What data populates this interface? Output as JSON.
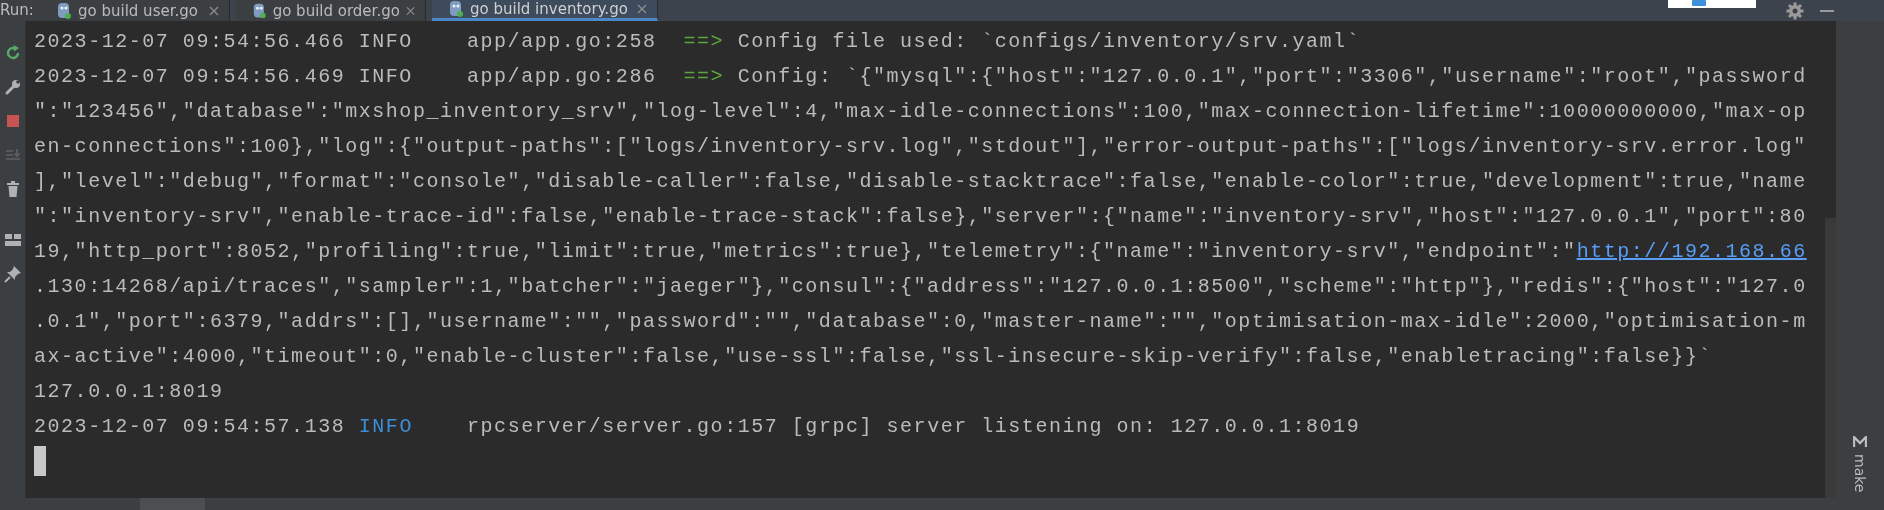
{
  "run_label": "Run:",
  "tabs": [
    {
      "label": "go build user.go",
      "selected": false
    },
    {
      "label": "go build order.go",
      "selected": false
    },
    {
      "label": "go build inventory.go",
      "selected": true
    }
  ],
  "console": {
    "cursor": true,
    "lines": [
      {
        "segments": [
          {
            "kind": "text",
            "text": "2023-12-07 09:54:56.466 INFO    app/app.go:258  "
          },
          {
            "kind": "arrow",
            "text": "==>"
          },
          {
            "kind": "text",
            "text": " Config file used: `configs/inventory/srv.yaml`"
          }
        ]
      },
      {
        "segments": [
          {
            "kind": "text",
            "text": "2023-12-07 09:54:56.469 INFO    app/app.go:286  "
          },
          {
            "kind": "arrow",
            "text": "==>"
          },
          {
            "kind": "text",
            "text": " Config: `{\"mysql\":{\"host\":\"127.0.0.1\",\"port\":\"3306\",\"username\":\"root\",\"password"
          }
        ]
      },
      {
        "segments": [
          {
            "kind": "text",
            "text": "\":\"123456\",\"database\":\"mxshop_inventory_srv\",\"log-level\":4,\"max-idle-connections\":100,\"max-connection-lifetime\":10000000000,\"max-op"
          }
        ]
      },
      {
        "segments": [
          {
            "kind": "text",
            "text": "en-connections\":100},\"log\":{\"output-paths\":[\"logs/inventory-srv.log\",\"stdout\"],\"error-output-paths\":[\"logs/inventory-srv.error.log\""
          }
        ]
      },
      {
        "segments": [
          {
            "kind": "text",
            "text": "],\"level\":\"debug\",\"format\":\"console\",\"disable-caller\":false,\"disable-stacktrace\":false,\"enable-color\":true,\"development\":true,\"name"
          }
        ]
      },
      {
        "segments": [
          {
            "kind": "text",
            "text": "\":\"inventory-srv\",\"enable-trace-id\":false,\"enable-trace-stack\":false},\"server\":{\"name\":\"inventory-srv\",\"host\":\"127.0.0.1\",\"port\":80"
          }
        ]
      },
      {
        "segments": [
          {
            "kind": "text",
            "text": "19,\"http_port\":8052,\"profiling\":true,\"limit\":true,\"metrics\":true},\"telemetry\":{\"name\":\"inventory-srv\",\"endpoint\":\""
          },
          {
            "kind": "link",
            "text": "http://192.168.66"
          }
        ]
      },
      {
        "segments": [
          {
            "kind": "text",
            "text": ".130:14268/api/traces\",\"sampler\":1,\"batcher\":\"jaeger\"},\"consul\":{\"address\":\"127.0.0.1:8500\",\"scheme\":\"http\"},\"redis\":{\"host\":\"127.0"
          }
        ]
      },
      {
        "segments": [
          {
            "kind": "text",
            "text": ".0.1\",\"port\":6379,\"addrs\":[],\"username\":\"\",\"password\":\"\",\"database\":0,\"master-name\":\"\",\"optimisation-max-idle\":2000,\"optimisation-m"
          }
        ]
      },
      {
        "segments": [
          {
            "kind": "text",
            "text": "ax-active\":4000,\"timeout\":0,\"enable-cluster\":false,\"use-ssl\":false,\"ssl-insecure-skip-verify\":false,\"enabletracing\":false}}`"
          }
        ]
      },
      {
        "segments": [
          {
            "kind": "text",
            "text": "127.0.0.1:8019"
          }
        ]
      },
      {
        "segments": [
          {
            "kind": "text",
            "text": "2023-12-07 09:54:57.138 "
          },
          {
            "kind": "info",
            "text": "INFO"
          },
          {
            "kind": "text",
            "text": "    rpcserver/server.go:157 [grpc] server listening on: 127.0.0.1:8019"
          }
        ]
      }
    ]
  },
  "right_panel": {
    "label": "make"
  }
}
